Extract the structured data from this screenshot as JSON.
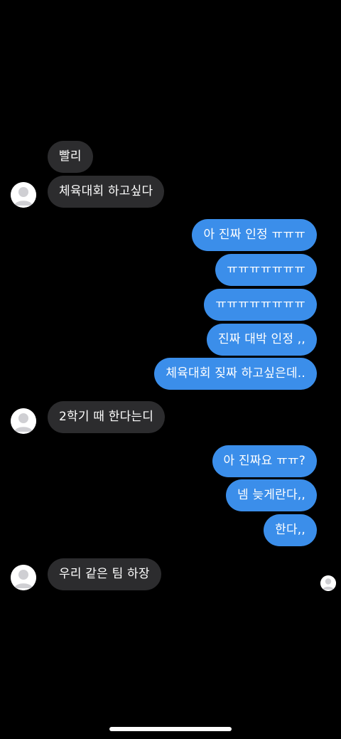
{
  "messages": [
    {
      "side": "in",
      "text": "빨리"
    },
    {
      "side": "in",
      "text": "체육대회 하고싶다"
    },
    {
      "side": "out",
      "text": "아 진짜 인정 ㅠㅠㅠ"
    },
    {
      "side": "out",
      "text": "ㅠㅠㅠㅠㅠㅠㅠ"
    },
    {
      "side": "out",
      "text": "ㅠㅠㅠㅠㅠㅠㅠㅠ"
    },
    {
      "side": "out",
      "text": "진짜 대박 인정 ,,"
    },
    {
      "side": "out",
      "text": "체육대회 짖짜 하고싶은데.."
    },
    {
      "side": "in",
      "text": "2학기 때 한다는디"
    },
    {
      "side": "out",
      "text": "아 진짜요 ㅠㅠ?"
    },
    {
      "side": "out",
      "text": "넴 늦게란다,,"
    },
    {
      "side": "out",
      "text": "한다,,"
    },
    {
      "side": "in",
      "text": "우리 같은 팀 하장"
    }
  ],
  "colors": {
    "background": "#000000",
    "incoming_bubble": "#2c2c2e",
    "outgoing_bubble": "#3b8eea",
    "text": "#ffffff"
  },
  "icons": {
    "avatar": "default-profile-icon",
    "read_receipt": "read-receipt-avatar-icon"
  }
}
